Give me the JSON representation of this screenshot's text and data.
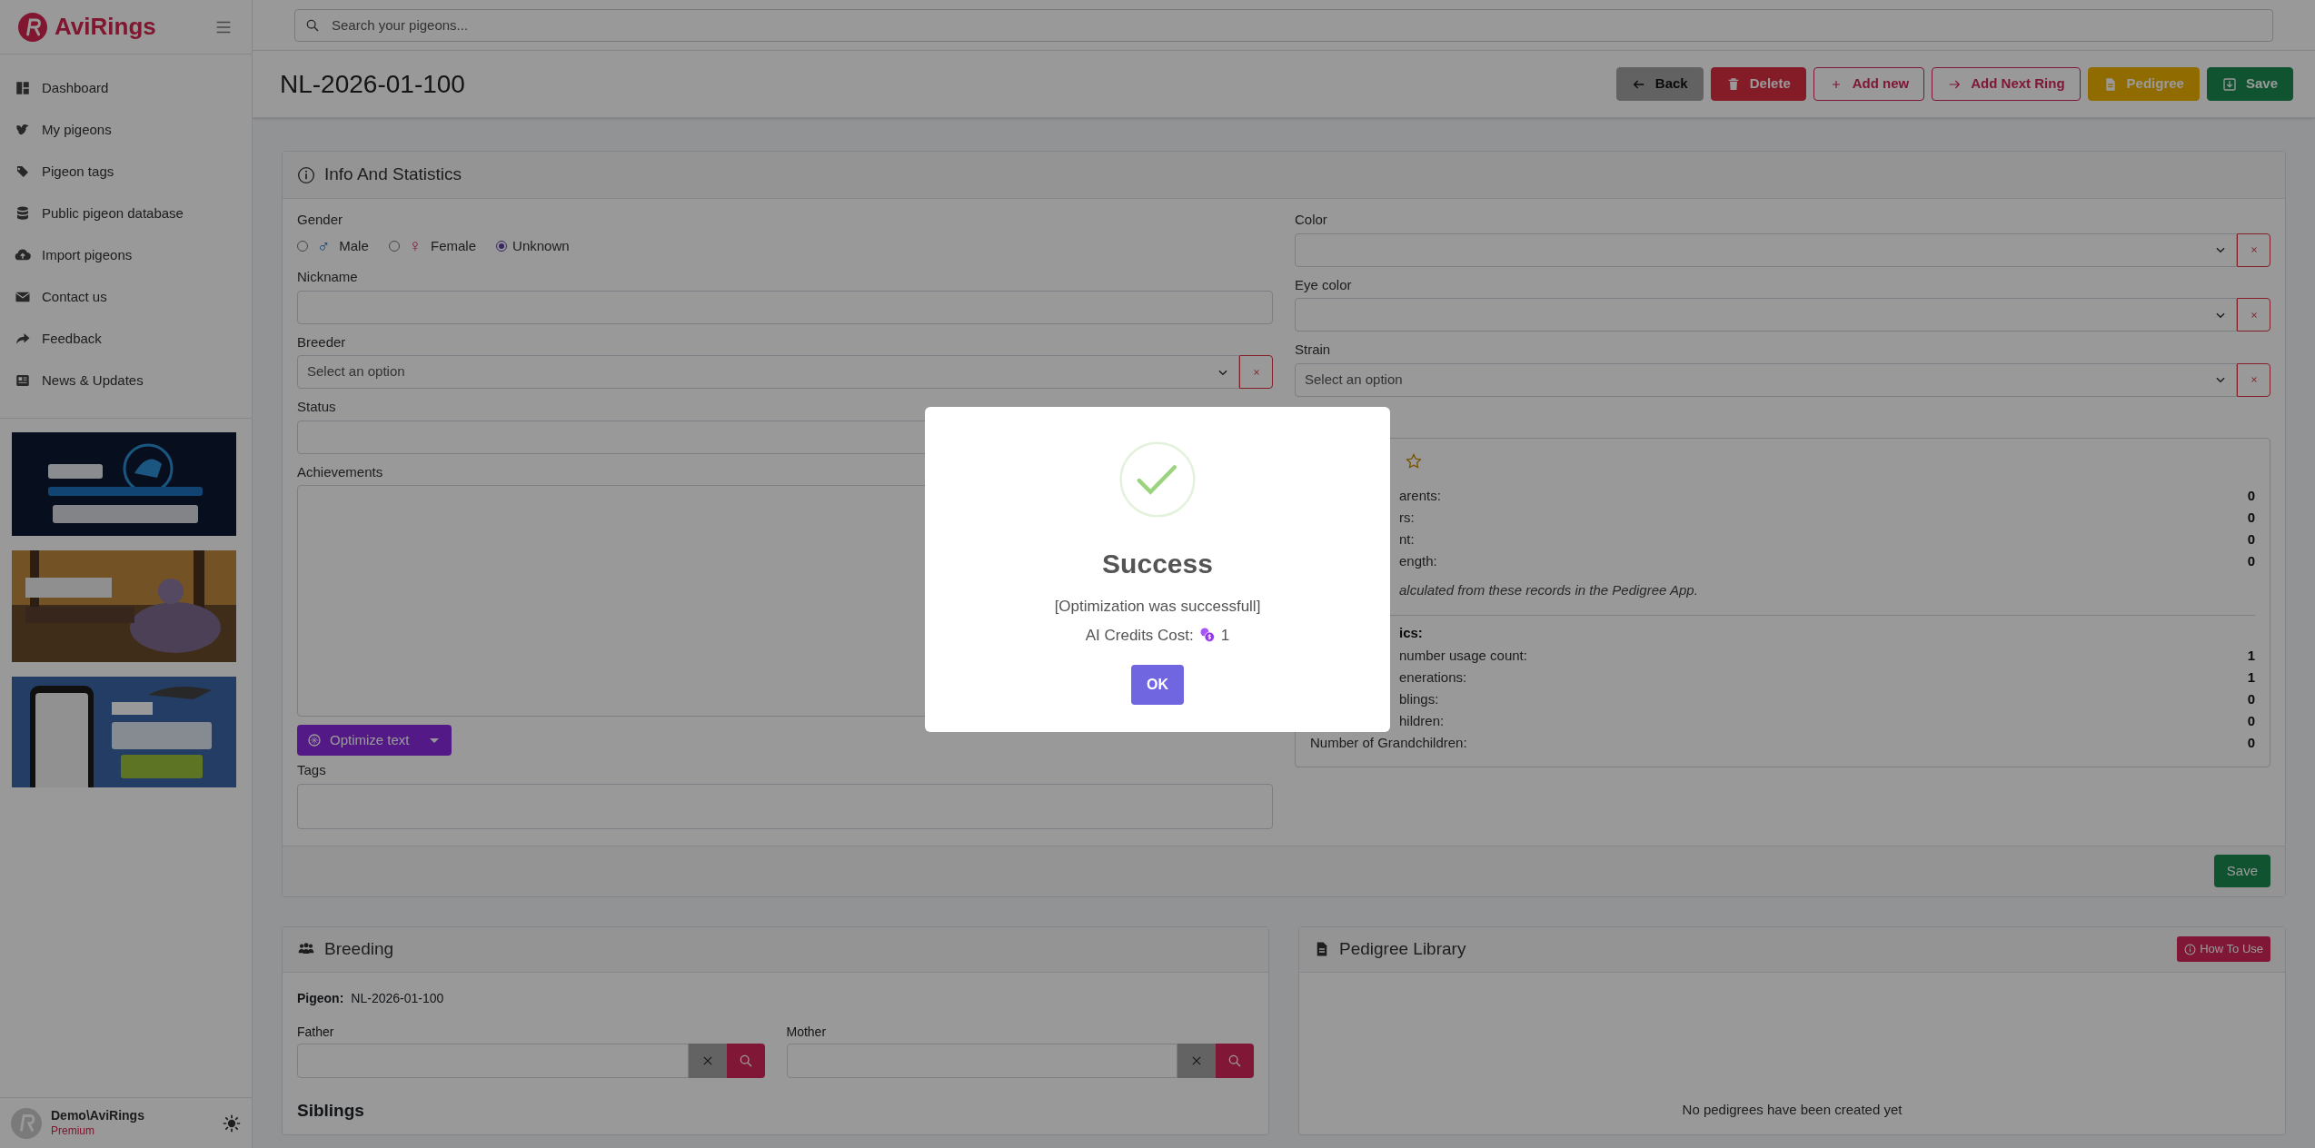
{
  "brand": "AviRings",
  "search": {
    "placeholder": "Search your pigeons..."
  },
  "sidebar": {
    "items": [
      {
        "label": "Dashboard"
      },
      {
        "label": "My pigeons"
      },
      {
        "label": "Pigeon tags"
      },
      {
        "label": "Public pigeon database"
      },
      {
        "label": "Import pigeons"
      },
      {
        "label": "Contact us"
      },
      {
        "label": "Feedback"
      },
      {
        "label": "News & Updates"
      }
    ],
    "user": {
      "name": "Demo\\AviRings",
      "plan": "Premium"
    }
  },
  "page_title": "NL-2026-01-100",
  "toolbar": [
    {
      "kind": "gray",
      "label": "Back"
    },
    {
      "kind": "danger",
      "label": "Delete"
    },
    {
      "kind": "outline",
      "label": "Add new"
    },
    {
      "kind": "outline-arrow",
      "label": "Add Next Ring"
    },
    {
      "kind": "warning",
      "label": "Pedigree"
    },
    {
      "kind": "success",
      "label": "Save"
    }
  ],
  "info": {
    "title": "Info And Statistics",
    "gender": {
      "label": "Gender",
      "options": [
        {
          "label": "Male",
          "symbol": "♂",
          "selected": false
        },
        {
          "label": "Female",
          "symbol": "♀",
          "selected": false
        },
        {
          "label": "Unknown",
          "selected": true
        }
      ]
    },
    "nickname": {
      "label": "Nickname"
    },
    "breeder": {
      "label": "Breeder",
      "placeholder": "Select an option"
    },
    "status": {
      "label": "Status"
    },
    "achievements": {
      "label": "Achievements"
    },
    "optimize": {
      "label": "Optimize text"
    },
    "tags": {
      "label": "Tags"
    },
    "color": {
      "label": "Color"
    },
    "eye_color": {
      "label": "Eye color"
    },
    "strain": {
      "label": "Strain",
      "placeholder": "Select an option"
    },
    "stats_top": [
      {
        "label": "arents:",
        "value": "0"
      },
      {
        "label": "rs:",
        "value": "0"
      },
      {
        "label": "nt:",
        "value": "0"
      },
      {
        "label": "ength:",
        "value": "0"
      }
    ],
    "stats_note": "alculated from these records in the Pedigree App.",
    "stats_heading": "ics:",
    "stats_bottom": [
      {
        "label": "number usage count:",
        "value": "1"
      },
      {
        "label": "enerations:",
        "value": "1"
      },
      {
        "label": "blings:",
        "value": "0"
      },
      {
        "label": "hildren:",
        "value": "0"
      }
    ],
    "stats_last": {
      "label": "Number of Grandchildren:",
      "value": "0"
    },
    "save": "Save"
  },
  "breeding": {
    "title": "Breeding",
    "pigeon_label": "Pigeon:",
    "pigeon_value": "NL-2026-01-100",
    "father": "Father",
    "mother": "Mother",
    "siblings": "Siblings"
  },
  "pedigree_library": {
    "title": "Pedigree Library",
    "help": "How To Use",
    "empty": "No pedigrees have been created yet"
  },
  "dialog": {
    "title": "Success",
    "message": "[Optimization was successfull]",
    "cost_label": "AI Credits Cost:",
    "cost_value": "1",
    "ok": "OK"
  }
}
